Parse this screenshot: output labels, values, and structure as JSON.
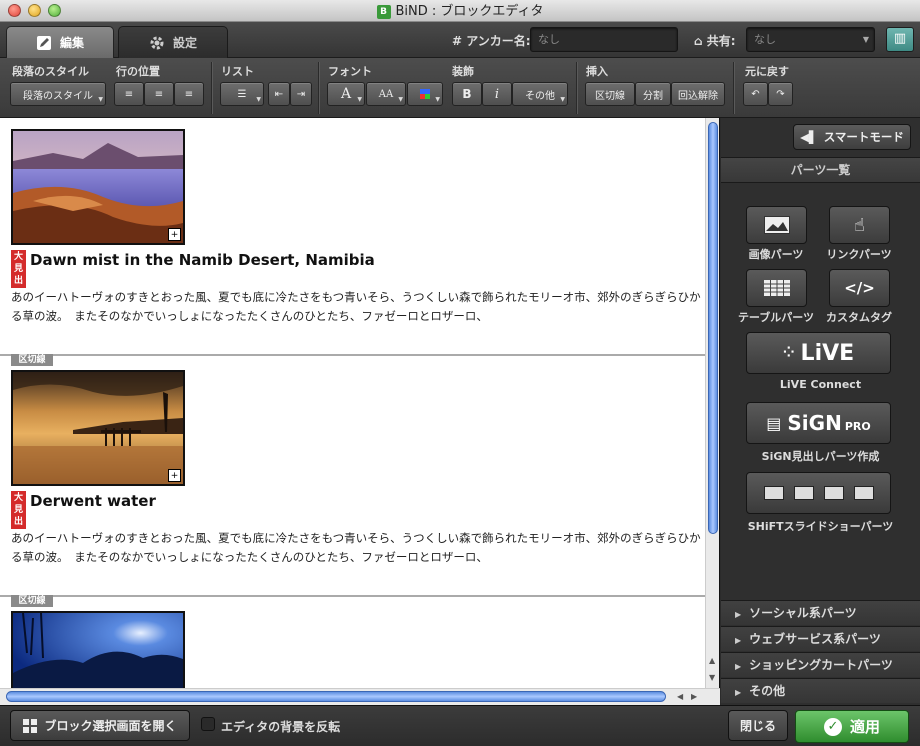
{
  "window": {
    "title": "BiND : ブロックエディタ",
    "logo": "B"
  },
  "tabs": [
    {
      "label": "編集",
      "icon": "pencil-icon"
    },
    {
      "label": "設定",
      "icon": "gear-icon"
    }
  ],
  "anchor": {
    "label": "# アンカー名:",
    "value": "なし"
  },
  "share": {
    "label": "共有:",
    "value": "なし"
  },
  "toolbar": {
    "groups": {
      "para_style": "段落のスタイル",
      "line_pos": "行の位置",
      "list": "リスト",
      "font": "フォント",
      "decoration": "装飾",
      "insert": "挿入",
      "undo": "元に戻す"
    },
    "para_style_btn": "段落のスタイル",
    "bold": "B",
    "italic": "i",
    "other": "その他",
    "insert_divider": "区切線",
    "insert_split": "分割",
    "insert_unwrap": "回込解除",
    "font_a": "A",
    "font_size": "AA"
  },
  "content": {
    "blocks": [
      {
        "badge": "大見出",
        "heading": "Dawn mist in the Namib Desert, Namibia",
        "body": "あのイーハトーヴォのすきとおった風、夏でも底に冷たさをもつ青いそら、うつくしい森で飾られたモリーオ市、郊外のぎらぎらひかる草の波。　またそのなかでいっしょになったたくさんのひとたち、ファゼーロとロザーロ、"
      },
      {
        "badge": "大見出",
        "heading": "Derwent water",
        "body": "あのイーハトーヴォのすきとおった風、夏でも底に冷たさをもつ青いそら、うつくしい森で飾られたモリーオ市、郊外のぎらぎらひかる草の波。　またそのなかでいっしょになったたくさんのひとたち、ファゼーロとロザーロ、"
      }
    ],
    "divider_label": "区切線"
  },
  "sidebar": {
    "smart_mode": "スマートモード",
    "parts_title": "パーツ一覧",
    "parts": [
      {
        "label": "画像パーツ",
        "icon": "image-icon"
      },
      {
        "label": "リンクパーツ",
        "icon": "hand-pointer-icon"
      },
      {
        "label": "テーブルパーツ",
        "icon": "table-icon"
      },
      {
        "label": "カスタムタグ",
        "icon": "code-icon"
      }
    ],
    "live": {
      "logo": "LiVE",
      "label": "LiVE Connect"
    },
    "sign": {
      "logo": "SiGN",
      "logo_suffix": "PRO",
      "label": "SiGN見出しパーツ作成"
    },
    "shift": {
      "label": "SHiFTスライドショーパーツ"
    },
    "categories": [
      "ソーシャル系パーツ",
      "ウェブサービス系パーツ",
      "ショッピングカートパーツ",
      "その他"
    ]
  },
  "footer": {
    "open_block": "ブロック選択画面を開く",
    "invert_bg": "エディタの背景を反転",
    "close": "閉じる",
    "apply": "適用"
  }
}
